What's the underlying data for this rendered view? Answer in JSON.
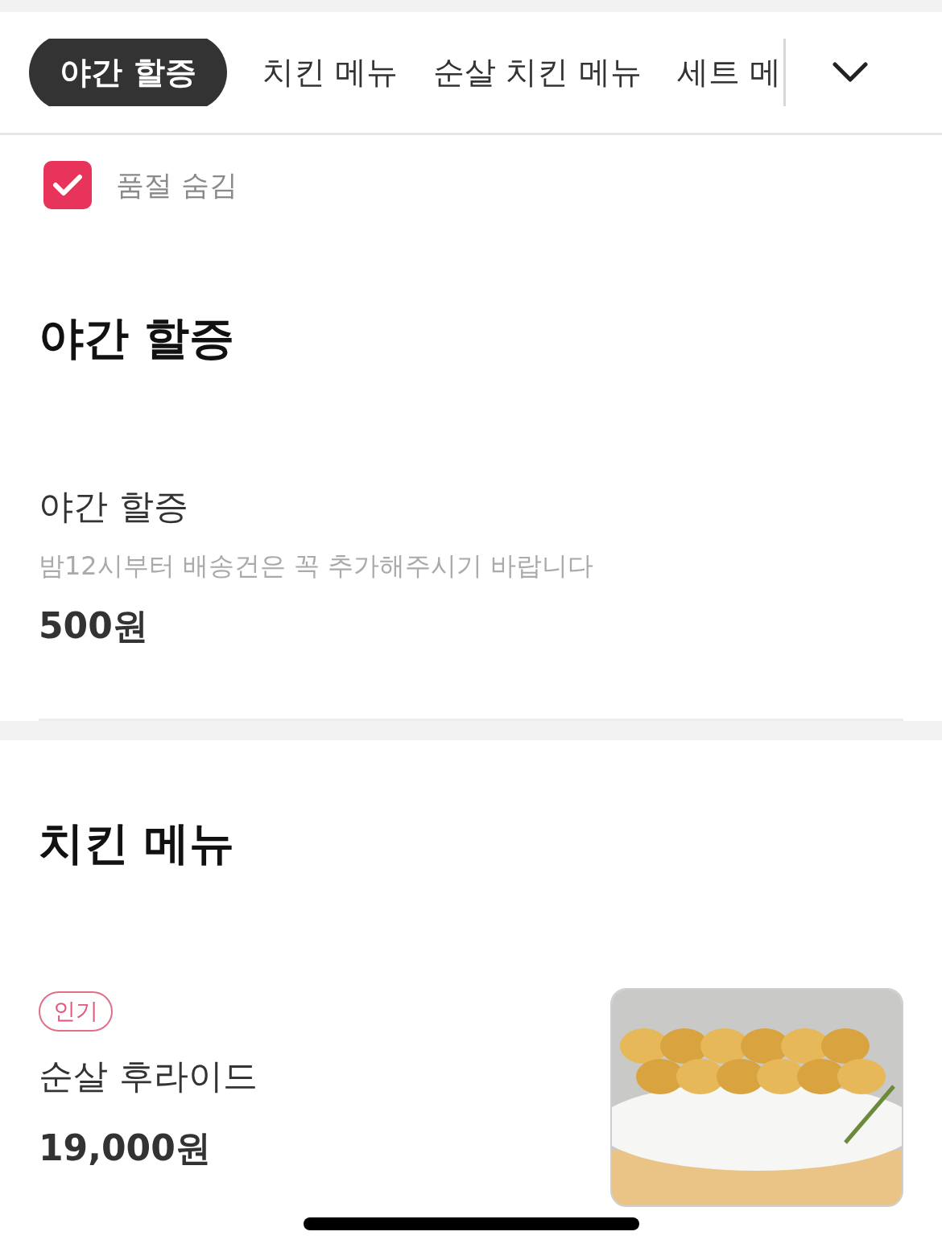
{
  "tabs": [
    {
      "label": "야간 할증",
      "selected": true
    },
    {
      "label": "치킨 메뉴",
      "selected": false
    },
    {
      "label": "순살 치킨 메뉴",
      "selected": false
    },
    {
      "label": "세트 메",
      "selected": false
    }
  ],
  "filter": {
    "label": "품절 숨김",
    "checked": true
  },
  "sections": [
    {
      "title": "야간 할증",
      "items": [
        {
          "name": "야간 할증",
          "description": "밤12시부터 배송건은 꼭 추가해주시기 바랍니다",
          "price": "500원"
        }
      ]
    },
    {
      "title": "치킨 메뉴",
      "items": [
        {
          "badge": "인기",
          "name": "순살 후라이드",
          "price": "19,000원"
        }
      ]
    }
  ]
}
